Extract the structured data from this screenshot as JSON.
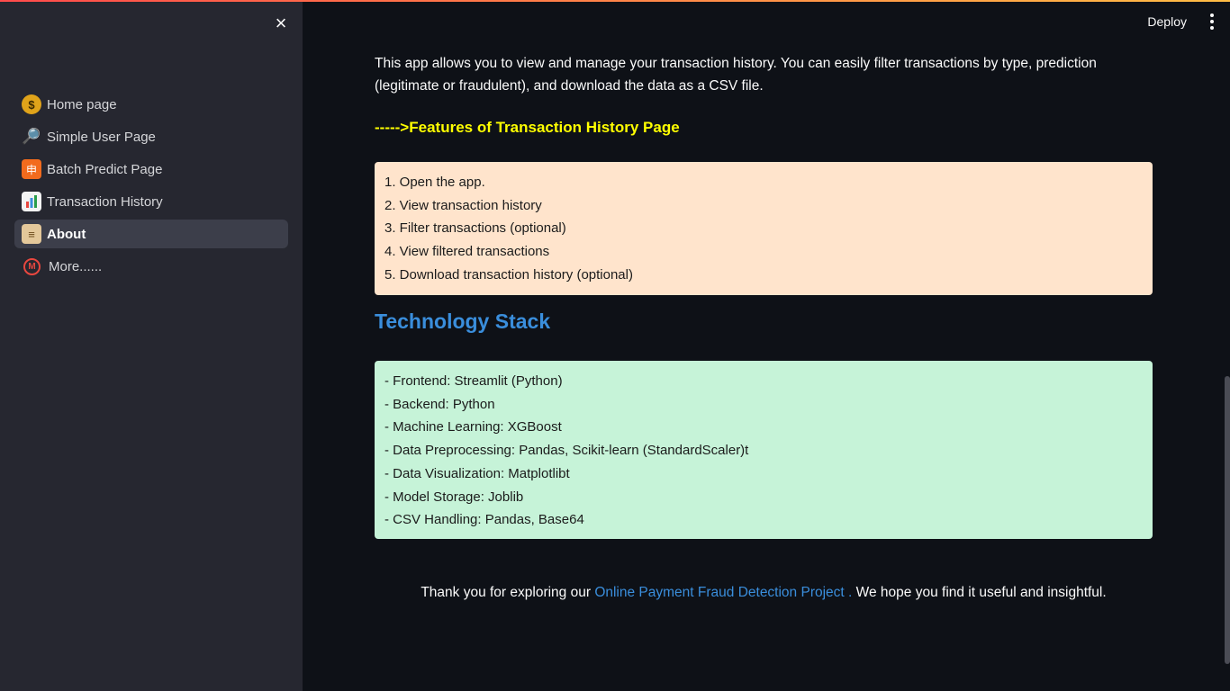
{
  "colors": {
    "sidebar_bg": "#262730",
    "main_bg": "#0e1117",
    "features_heading": "#ffff00",
    "tech_heading": "#3a8edc",
    "features_box_bg": "#ffe4cc",
    "tech_box_bg": "#c6f3d8",
    "link": "#3a8edc"
  },
  "sidebar": {
    "close_icon": "×",
    "items": [
      {
        "icon": "money-bag-icon",
        "glyph": "$",
        "label": "Home page",
        "active": false
      },
      {
        "icon": "magnifier-icon",
        "glyph": "🔎",
        "label": "Simple User Page",
        "active": false
      },
      {
        "icon": "batch-icon",
        "glyph": "申",
        "label": "Batch Predict Page",
        "active": false
      },
      {
        "icon": "bar-chart-icon",
        "glyph": "",
        "label": "Transaction History",
        "active": false
      },
      {
        "icon": "scroll-icon",
        "glyph": "≡",
        "label": "About",
        "active": true
      },
      {
        "icon": "m-circle-icon",
        "glyph": "M",
        "label": "More......",
        "active": false
      }
    ]
  },
  "header": {
    "deploy_label": "Deploy",
    "menu_icon": "kebab-menu-icon"
  },
  "main": {
    "intro": "This app allows you to view and manage your transaction history. You can easily filter transactions by type, prediction (legitimate or fraudulent), and download the data as a CSV file.",
    "features_heading": "----->Features of Transaction History Page",
    "features": [
      "1. Open the app.",
      "2. View transaction history",
      "3. Filter transactions (optional)",
      "4. View filtered transactions",
      "5. Download transaction history (optional)"
    ],
    "tech_heading": "Technology Stack",
    "tech": [
      "- Frontend: Streamlit (Python)",
      "- Backend: Python",
      "- Machine Learning: XGBoost",
      "- Data Preprocessing: Pandas, Scikit-learn (StandardScaler)t",
      "- Data Visualization: Matplotlibt",
      "- Model Storage: Joblib",
      "- CSV Handling: Pandas, Base64"
    ],
    "thanks_prefix": "Thank you for exploring our ",
    "thanks_link": "Online Payment Fraud Detection Project .",
    "thanks_suffix": " We hope you find it useful and insightful."
  }
}
